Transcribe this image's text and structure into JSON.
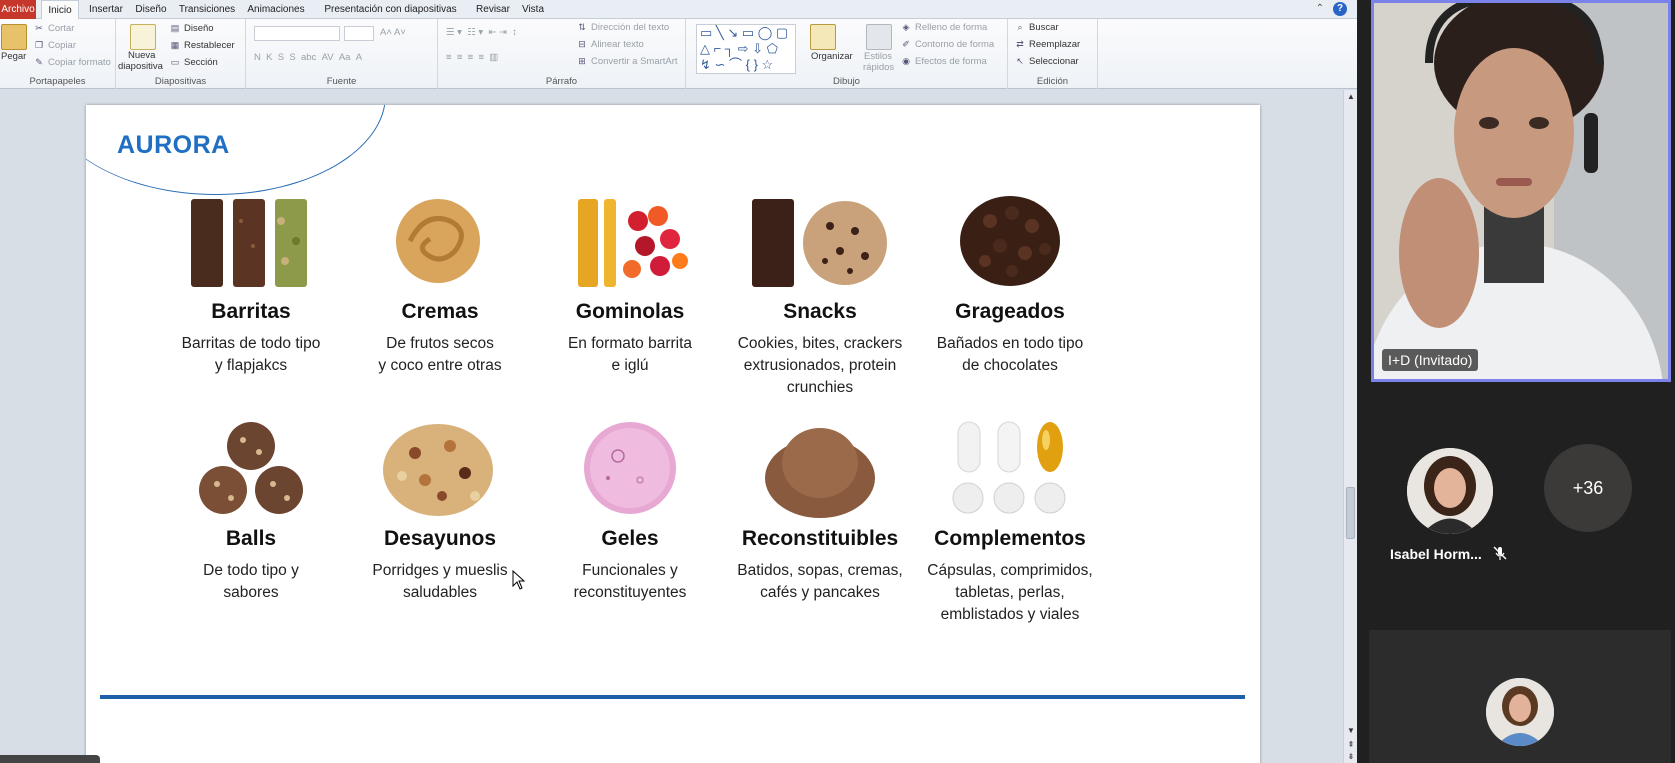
{
  "ppt": {
    "tabs": [
      "Archivo",
      "Inicio",
      "Insertar",
      "Diseño",
      "Transiciones",
      "Animaciones",
      "Presentación con diapositivas",
      "Revisar",
      "Vista"
    ],
    "ribbon": {
      "portapapeles": {
        "label": "Portapapeles",
        "pegar": "Pegar",
        "cortar": "Cortar",
        "copiar": "Copiar",
        "copiar_formato": "Copiar formato"
      },
      "diapositivas": {
        "label": "Diapositivas",
        "nueva": "Nueva",
        "nueva2": "diapositiva",
        "diseno": "Diseño",
        "restablecer": "Restablecer",
        "seccion": "Sección"
      },
      "fuente": {
        "label": "Fuente"
      },
      "parrafo": {
        "label": "Párrafo",
        "direccion": "Dirección del texto",
        "alinear": "Alinear texto",
        "smartart": "Convertir a SmartArt"
      },
      "dibujo": {
        "label": "Dibujo",
        "organizar": "Organizar",
        "estilos": "Estilos",
        "rapidos": "rápidos",
        "relleno": "Relleno de forma",
        "contorno": "Contorno de forma",
        "efectos": "Efectos de forma"
      },
      "edicion": {
        "label": "Edición",
        "buscar": "Buscar",
        "reemplazar": "Reemplazar",
        "seleccionar": "Seleccionar"
      }
    },
    "slide": {
      "brand": "AURORA",
      "items": [
        {
          "title": "Barritas",
          "desc": "Barritas de todo tipo\ny flapjakcs"
        },
        {
          "title": "Cremas",
          "desc": "De frutos secos\ny coco entre otras"
        },
        {
          "title": "Gominolas",
          "desc": "En formato barrita\ne iglú"
        },
        {
          "title": "Snacks",
          "desc": "Cookies, bites, crackers\nextrusionados, protein\ncrunchies"
        },
        {
          "title": "Grageados",
          "desc": "Bañados en todo tipo\nde chocolates"
        },
        {
          "title": "Balls",
          "desc": "De todo tipo y\nsabores"
        },
        {
          "title": "Desayunos",
          "desc": "Porridges y mueslis\nsaludables"
        },
        {
          "title": "Geles",
          "desc": "Funcionales y\nreconstituyentes"
        },
        {
          "title": "Reconstituibles",
          "desc": "Batidos, sopas, cremas,\ncafés y pancakes"
        },
        {
          "title": "Complementos",
          "desc": "Cápsulas, comprimidos,\ntabletas, perlas,\nemblistados y viales"
        }
      ]
    }
  },
  "teams": {
    "main_video_name": "I+D (Invitado)",
    "participant1_name": "Isabel Horm...",
    "more_count": "+36"
  },
  "colors": {
    "brand_blue": "#1f6fc2",
    "divider_blue": "#1f5fa8",
    "teams_bg": "#202020",
    "speaker_border": "#7b83eb"
  }
}
